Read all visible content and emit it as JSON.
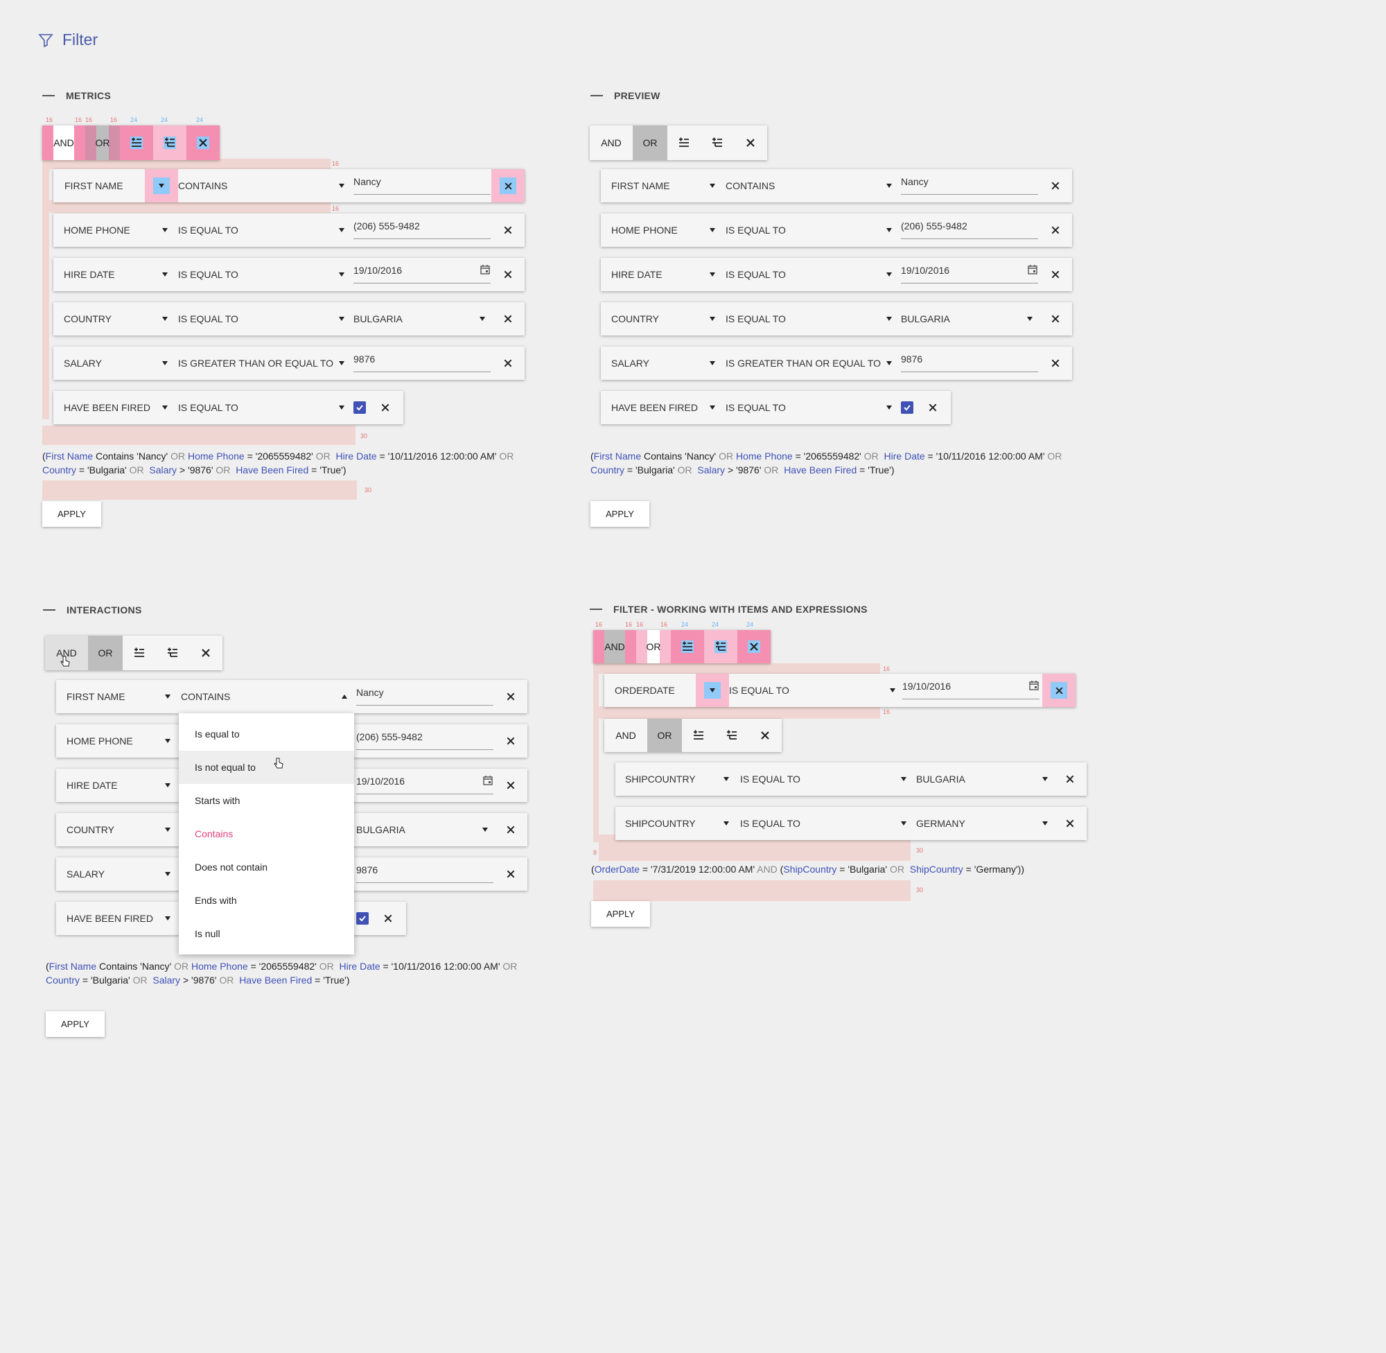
{
  "header": {
    "title": "Filter"
  },
  "toolbar": {
    "and": "AND",
    "or": "OR"
  },
  "sections": {
    "metrics": "METRICS",
    "preview": "PREVIEW",
    "interactions": "INTERACTIONS",
    "items": "FILTER - WORKING WITH ITEMS AND EXPRESSIONS"
  },
  "rows": [
    {
      "field": "FIRST NAME",
      "condition": "CONTAINS",
      "value": "Nancy"
    },
    {
      "field": "HOME PHONE",
      "condition": "IS EQUAL TO",
      "value": "(206) 555-9482"
    },
    {
      "field": "HIRE DATE",
      "condition": "IS EQUAL TO",
      "value": "19/10/2016"
    },
    {
      "field": "COUNTRY",
      "condition": "IS EQUAL TO",
      "value": "BULGARIA"
    },
    {
      "field": "SALARY",
      "condition": "IS GREATER THAN OR EQUAL TO",
      "value": "9876"
    },
    {
      "field": "HAVE BEEN FIRED",
      "condition": "IS EQUAL TO",
      "value": "true"
    }
  ],
  "expr": {
    "open": "(",
    "f1": "First Name",
    "t1": " Contains 'Nancy' ",
    "or": "OR",
    "f2": "Home Phone",
    "t2": " = '2065559482' ",
    "f3": "Hire Date",
    "t3": " = '10/11/2016 12:00:00 AM' ",
    "f4": "Country",
    "t4": " = 'Bulgaria' ",
    "f5": "Salary",
    "t5": " > '9876' ",
    "f6": "Have Been Fired",
    "t6": " = 'True')"
  },
  "apply": "APPLY",
  "dropdown": [
    "Is equal to",
    "Is not equal to",
    "Starts with",
    "Contains",
    "Does not contain",
    "Ends with",
    "Is null"
  ],
  "items": {
    "row1": {
      "field": "ORDERDATE",
      "condition": "IS EQUAL TO",
      "value": "19/10/2016"
    },
    "row2": {
      "field": "SHIPCOUNTRY",
      "condition": "IS EQUAL TO",
      "value": "BULGARIA"
    },
    "row3": {
      "field": "SHIPCOUNTRY",
      "condition": "IS EQUAL TO",
      "value": "GERMANY"
    },
    "expr": {
      "open": "(",
      "f1": "OrderDate",
      "t1": " = '7/31/2019 12:00:00 AM' ",
      "and": "AND",
      "open2": " (",
      "f2": "ShipCountry",
      "t2": " = 'Bulgaria' ",
      "or": "OR",
      "f3": "ShipCountry",
      "t3": " = 'Germany'))"
    }
  },
  "spec": {
    "a": "16",
    "b": "24",
    "c": "40",
    "d": "30",
    "e": "8"
  }
}
